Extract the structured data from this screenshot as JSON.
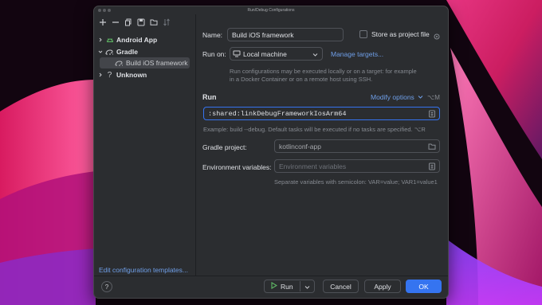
{
  "window": {
    "title": "Run/Debug Configurations"
  },
  "sidebar": {
    "toolbar": [
      {
        "name": "add-icon"
      },
      {
        "name": "remove-icon"
      },
      {
        "name": "copy-icon"
      },
      {
        "name": "save-icon"
      },
      {
        "name": "folder-icon"
      },
      {
        "name": "sort-icon"
      }
    ],
    "tree": [
      {
        "label": "Android App",
        "icon": "android-icon",
        "expanded": false
      },
      {
        "label": "Gradle",
        "icon": "gradle-icon",
        "expanded": true
      },
      {
        "label": "Build iOS framework",
        "icon": "gradle-icon",
        "selected": true
      },
      {
        "label": "Unknown",
        "icon": "question-icon",
        "expanded": false
      }
    ],
    "edit_templates": "Edit configuration templates..."
  },
  "form": {
    "name_label": "Name:",
    "name_value": "Build iOS framework",
    "store_label": "Store as project file",
    "run_on_label": "Run on:",
    "run_on_value": "Local machine",
    "manage_targets": "Manage targets...",
    "run_on_hint": "Run configurations may be executed locally or on a target: for example in a Docker Container or on a remote host using SSH.",
    "run_section": "Run",
    "modify_options": "Modify options",
    "modify_shortcut": "⌥M",
    "tasks_value": ":shared:linkDebugFrameworkIosArm64",
    "tasks_hint": "Example: build --debug. Default tasks will be executed if no tasks are specified.",
    "tasks_hint_shortcut": "⌥R",
    "gradle_project_label": "Gradle project:",
    "gradle_project_value": "kotlinconf-app",
    "env_label": "Environment variables:",
    "env_placeholder": "Environment variables",
    "env_hint": "Separate variables with semicolon: VAR=value; VAR1=value1"
  },
  "footer": {
    "help": "?",
    "run": "Run",
    "cancel": "Cancel",
    "apply": "Apply",
    "ok": "OK"
  },
  "colors": {
    "accent": "#3574f0",
    "link": "#6f9fe8",
    "dialog_bg": "#2b2d30"
  }
}
